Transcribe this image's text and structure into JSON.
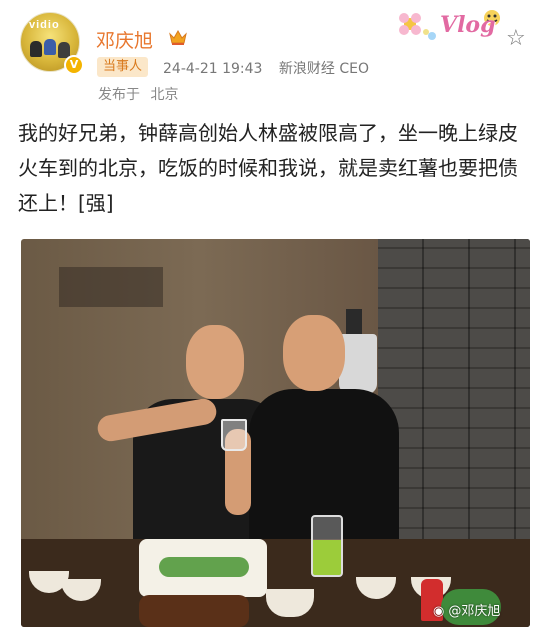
{
  "header": {
    "name": "邓庆旭",
    "badge": "当事人",
    "timestamp": "24-4-21 19:43",
    "source": "新浪财经 CEO",
    "location_label": "发布于",
    "location": "北京",
    "vlog": "Vlog"
  },
  "avatar": {
    "text": "vidio"
  },
  "post": {
    "text": "我的好兄弟，钟薛高创始人林盛被限高了，坐一晚上绿皮火车到的北京，吃饭的时候和我说，就是卖红薯也要把债还上！[强]"
  },
  "watermark": {
    "text": "@邓庆旭"
  },
  "colors": {
    "name": "#e8772e",
    "badge_bg": "#fbe7c9",
    "badge_text": "#d97a1d",
    "meta": "#777777"
  }
}
